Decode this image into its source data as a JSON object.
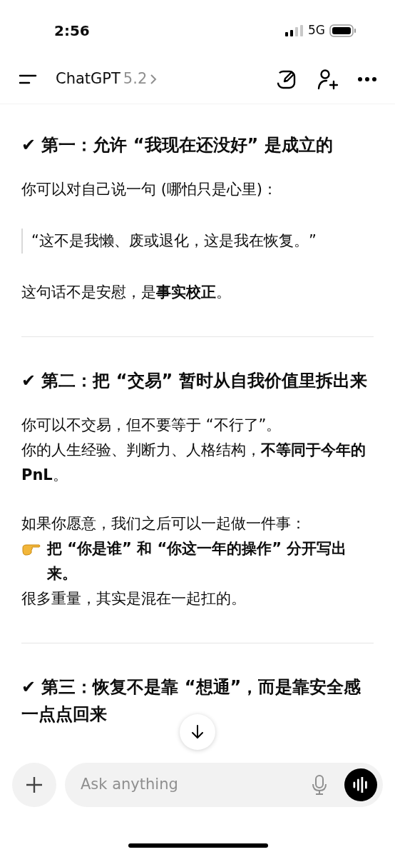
{
  "status_bar": {
    "time": "2:56",
    "network": "5G"
  },
  "header": {
    "title": "ChatGPT",
    "version": "5.2"
  },
  "sections": [
    {
      "heading": "✔ 第一：允许 “我现在还没好” 是成立的",
      "blocks": [
        {
          "kind": "text",
          "lines": [
            {
              "kind": "text",
              "text": "你可以对自己说一句 (哪怕只是心里)："
            }
          ]
        },
        {
          "kind": "quote",
          "lines": [
            {
              "text": "“这不是我懒、废或退化，这是我在恢复。”"
            }
          ]
        },
        {
          "kind": "text",
          "lines": [
            {
              "kind": "text",
              "text": "这句话不是安慰，是**事实校正**。"
            }
          ]
        }
      ]
    },
    {
      "heading": "✔ 第二：把 “交易” 暂时从自我价值里拆出来",
      "blocks": [
        {
          "kind": "text",
          "lines": [
            {
              "kind": "text",
              "text": "你可以不交易，但不要等于 “不行了”。"
            },
            {
              "kind": "text",
              "text": "你的人生经验、判断力、人格结构，**不等同于今年的 PnL**。"
            }
          ]
        },
        {
          "kind": "text",
          "lines": [
            {
              "kind": "text",
              "text": "如果你愿意，我们之后可以一起做一件事："
            },
            {
              "kind": "pointer",
              "text": "把 “你是谁” 和 “你这一年的操作” 分开写出来。"
            },
            {
              "kind": "text",
              "text": "很多重量，其实是混在一起扛的。"
            }
          ]
        }
      ]
    },
    {
      "heading": "✔ 第三：恢复不是靠 “想通”，而是靠安全感一点点回来"
    }
  ],
  "composer": {
    "placeholder": "Ask anything"
  }
}
